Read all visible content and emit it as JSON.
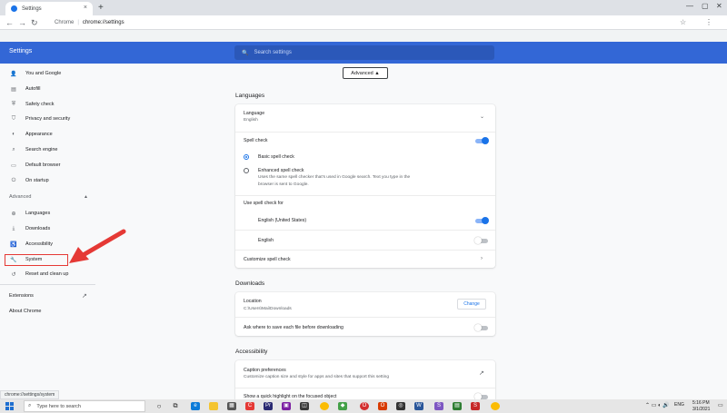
{
  "browser": {
    "tab_title": "Settings",
    "tab_close": "×",
    "new_tab": "+",
    "window_controls": [
      "—",
      "▢",
      "✕"
    ],
    "nav": {
      "back": "←",
      "forward": "→",
      "reload": "↻"
    },
    "omnibox": {
      "site": "Chrome",
      "separator": "|",
      "url": "chrome://settings"
    },
    "status_url": "chrome://settings/system"
  },
  "header": {
    "title": "Settings",
    "search_placeholder": "Search settings"
  },
  "sidebar": {
    "items": [
      {
        "icon": "person-icon",
        "glyph": "👤",
        "label": "You and Google"
      },
      {
        "icon": "autofill-icon",
        "glyph": "▤",
        "label": "Autofill"
      },
      {
        "icon": "shield-icon",
        "glyph": "⛨",
        "label": "Safety check"
      },
      {
        "icon": "shield-lock-icon",
        "glyph": "⛉",
        "label": "Privacy and security"
      },
      {
        "icon": "palette-icon",
        "glyph": "◐",
        "label": "Appearance"
      },
      {
        "icon": "search-icon",
        "glyph": "⌕",
        "label": "Search engine"
      },
      {
        "icon": "browser-icon",
        "glyph": "▭",
        "label": "Default browser"
      },
      {
        "icon": "power-icon",
        "glyph": "⏻",
        "label": "On startup"
      }
    ],
    "advanced_label": "Advanced",
    "advanced_chevron": "▲",
    "advanced_items": [
      {
        "icon": "globe-icon",
        "glyph": "⊕",
        "label": "Languages"
      },
      {
        "icon": "download-icon",
        "glyph": "⤓",
        "label": "Downloads"
      },
      {
        "icon": "accessibility-icon",
        "glyph": "♿",
        "label": "Accessibility"
      },
      {
        "icon": "wrench-icon",
        "glyph": "🔧",
        "label": "System"
      },
      {
        "icon": "history-icon",
        "glyph": "↺",
        "label": "Reset and clean up"
      }
    ],
    "extensions_label": "Extensions",
    "external_link_glyph": "↗",
    "about_label": "About Chrome"
  },
  "main": {
    "advanced_button": "Advanced ▲",
    "languages": {
      "section_title": "Languages",
      "language_label": "Language",
      "language_value": "English",
      "spell_check_label": "Spell check",
      "spell_check_on": true,
      "basic_label": "Basic spell check",
      "enhanced_label": "Enhanced spell check",
      "enhanced_desc_1": "Uses the same spell checker that's used in Google search. Text you type in the",
      "enhanced_desc_2": "browser is sent to Google.",
      "use_for_label": "Use spell check for",
      "lang_us": "English (United States)",
      "lang_us_on": true,
      "lang_en": "English",
      "lang_en_on": false,
      "customize_label": "Customize spell check"
    },
    "downloads": {
      "section_title": "Downloads",
      "location_label": "Location",
      "location_value": "C:\\Users\\Mai\\Downloads",
      "change_button": "Change",
      "ask_label": "Ask where to save each file before downloading",
      "ask_on": false
    },
    "accessibility": {
      "section_title": "Accessibility",
      "caption_label": "Caption preferences",
      "caption_desc": "Customize caption size and style for apps and sites that support this setting",
      "highlight_label": "Show a quick highlight on the focused object"
    }
  },
  "taskbar": {
    "search_placeholder": "Type here to search",
    "language": "ENG",
    "time": "5:16 PM",
    "date": "3/1/2021"
  },
  "colors": {
    "header_blue": "#3367d6",
    "accent_blue": "#1a73e8",
    "annotation_red": "#e53935"
  }
}
